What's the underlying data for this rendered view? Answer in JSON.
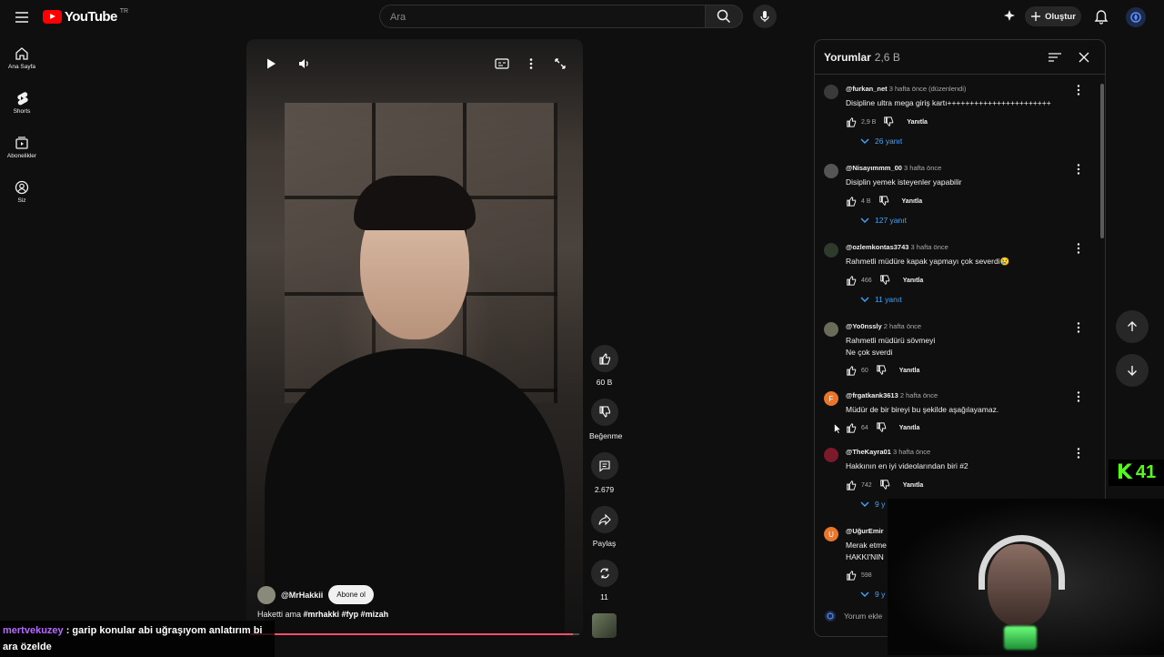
{
  "topbar": {
    "logo_text": "YouTube",
    "country_code": "TR",
    "search_placeholder": "Ara",
    "create_label": "Oluştur"
  },
  "sidebar": {
    "items": [
      {
        "label": "Ana Sayfa",
        "icon": "home-icon"
      },
      {
        "label": "Shorts",
        "icon": "shorts-icon"
      },
      {
        "label": "Abonelikler",
        "icon": "subscriptions-icon"
      },
      {
        "label": "Siz",
        "icon": "you-icon"
      }
    ]
  },
  "short": {
    "channel": "@MrHakkii",
    "subscribe_label": "Abone ol",
    "caption_plain": "Haketti ama ",
    "caption_tags": "#mrhakki #fyp #mizah",
    "progress_fraction": 0.98
  },
  "actions": {
    "like_count": "60 B",
    "dislike_label": "Beğenme",
    "comment_count": "2.679",
    "share_label": "Paylaş",
    "remix_count": "11"
  },
  "comments": {
    "title": "Yorumlar",
    "count": "2,6 B",
    "input_placeholder": "Yorum ekle",
    "reply_label": "Yanıtla",
    "items": [
      {
        "author": "@furkan_net",
        "time": "3 hafta önce (düzenlendi)",
        "text": "Disipline ultra mega giriş kartı+++++++++++++++++++++++",
        "likes": "2,9 B",
        "replies": "26 yanıt",
        "avatar_color": "#3a3a3a"
      },
      {
        "author": "@Nisayımmm_00",
        "time": "3 hafta önce",
        "text": "Disiplin yemek isteyenler yapabilir",
        "likes": "4 B",
        "replies": "127 yanıt",
        "avatar_color": "#555555"
      },
      {
        "author": "@ozlemkontas3743",
        "time": "3 hafta önce",
        "text": "Rahmetli müdüre kapak yapmayı çok severdi😢",
        "likes": "466",
        "replies": "11 yanıt",
        "avatar_color": "#2f3a2a"
      },
      {
        "author": "@Yo0nssly",
        "time": "2 hafta önce",
        "text": "Rahmetli müdürü sövmeyi\nNe çok sverdi",
        "likes": "60",
        "replies": "",
        "avatar_color": "#6b6b5a"
      },
      {
        "author": "@frgatkank3613",
        "time": "2 hafta önce",
        "text": "Müdür de bir bireyi bu şekilde aşağılayamaz.",
        "likes": "64",
        "replies": "",
        "avatar_color": "#e8762b",
        "avatar_letter": "F"
      },
      {
        "author": "@TheKayra01",
        "time": "3 hafta önce",
        "text": "Hakkının en iyi videolarından biri #2",
        "likes": "742",
        "replies": "9 y",
        "avatar_color": "#7a1a2a"
      },
      {
        "author": "@UğurEmir",
        "time": "",
        "text": "Merak etme\nHAKKI'NIN",
        "likes": "598",
        "replies": "9 y",
        "avatar_color": "#e8762b",
        "avatar_letter": "U"
      }
    ]
  },
  "badge": {
    "number": "41",
    "letter": "K"
  },
  "chat": {
    "user": "mertvekuzey",
    "message": " : garip konular abi uğraşıyom anlatırım bi ara özelde"
  },
  "colors": {
    "background": "#0f0f0f",
    "accent_blue": "#3ea6ff",
    "brand_red": "#ff0000",
    "kick_green": "#53fc18",
    "chat_user": "#b66bff"
  }
}
